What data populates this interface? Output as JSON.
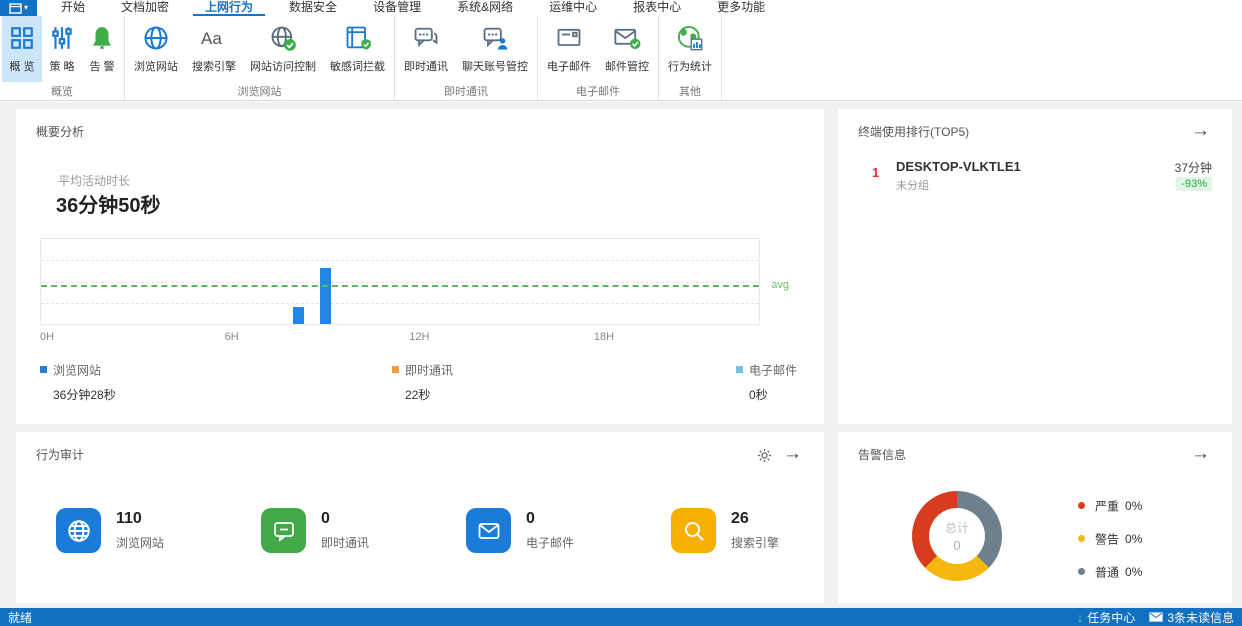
{
  "app": {
    "menu_button_caret": "▾",
    "tabs": [
      "开始",
      "文档加密",
      "上网行为",
      "数据安全",
      "设备管理",
      "系统&网络",
      "运维中心",
      "报表中心",
      "更多功能"
    ],
    "active_tab": "上网行为",
    "accent_color": "#1374cf",
    "ribbon": {
      "groups": [
        {
          "label": "概览",
          "buttons": [
            {
              "label": "概 览"
            },
            {
              "label": "策 略"
            },
            {
              "label": "告 警"
            }
          ]
        },
        {
          "label": "浏览网站",
          "buttons": [
            {
              "label": "浏览网站"
            },
            {
              "label": "搜索引擎"
            },
            {
              "label": "网站访问控制"
            },
            {
              "label": "敏感词拦截"
            }
          ]
        },
        {
          "label": "即时通讯",
          "buttons": [
            {
              "label": "即时通讯"
            },
            {
              "label": "聊天账号管控"
            }
          ]
        },
        {
          "label": "电子邮件",
          "buttons": [
            {
              "label": "电子邮件"
            },
            {
              "label": "邮件管控"
            }
          ]
        },
        {
          "label": "其他",
          "buttons": [
            {
              "label": "行为统计"
            }
          ]
        }
      ]
    }
  },
  "summary_panel": {
    "title": "概要分析",
    "avg_label": "平均活动时长",
    "avg_value": "36分钟50秒",
    "chart_data": {
      "type": "bar",
      "title": "平均活动时长 36分钟50秒",
      "x_ticks": [
        {
          "label": "0H",
          "hour": 0
        },
        {
          "label": "6H",
          "hour": 6
        },
        {
          "label": "12H",
          "hour": 12
        },
        {
          "label": "18H",
          "hour": 18
        }
      ],
      "x_range_hours": [
        0,
        24
      ],
      "bars": [
        {
          "hour": 8.2,
          "height_pct": 20
        },
        {
          "hour": 9.1,
          "height_pct": 66
        }
      ],
      "bar_color": "#2086e8",
      "avg_line": {
        "label": "avg",
        "height_pct": 44,
        "color": "#5cb85c"
      },
      "grid": "dashed horizontal"
    },
    "legend": [
      {
        "label": "浏览网站",
        "value": "36分钟28秒",
        "color": "#2a7ed1"
      },
      {
        "label": "即时通讯",
        "value": "22秒",
        "color": "#f09f3c"
      },
      {
        "label": "电子邮件",
        "value": "0秒",
        "color": "#74c3e2"
      }
    ]
  },
  "ranking_panel": {
    "title": "终端使用排行(TOP5)",
    "items": [
      {
        "rank": "1",
        "name": "DESKTOP-VLKTLE1",
        "group": "未分组",
        "duration": "37分钟",
        "change": "-93%",
        "rank_color": "#e03131",
        "change_color": "#28a745"
      }
    ]
  },
  "audit_panel": {
    "title": "行为审计",
    "stats": [
      {
        "value": "110",
        "label": "浏览网站",
        "icon": "globe-icon",
        "color": "#1a7cd8"
      },
      {
        "value": "0",
        "label": "即时通讯",
        "icon": "chat-icon",
        "color": "#43a848"
      },
      {
        "value": "0",
        "label": "电子邮件",
        "icon": "mail-icon",
        "color": "#1a7cd8"
      },
      {
        "value": "26",
        "label": "搜索引擎",
        "icon": "search-icon",
        "color": "#f7af00"
      }
    ]
  },
  "alarm_panel": {
    "title": "告警信息",
    "chart_data": {
      "type": "pie",
      "center_label": "总计",
      "center_value": "0",
      "segments": [
        {
          "name": "普通",
          "color": "#6e7f8d",
          "from_deg": 0,
          "to_deg": 135
        },
        {
          "name": "警告",
          "color": "#f6b70f",
          "from_deg": 135,
          "to_deg": 225
        },
        {
          "name": "严重",
          "color": "#d63c1d",
          "from_deg": 225,
          "to_deg": 360
        }
      ]
    },
    "legend": [
      {
        "label": "严重",
        "value": "0%",
        "color": "#d63c1d"
      },
      {
        "label": "警告",
        "value": "0%",
        "color": "#f6b70f"
      },
      {
        "label": "普通",
        "value": "0%",
        "color": "#6e7f8d"
      }
    ]
  },
  "statusbar": {
    "left": "就绪",
    "task_center": "任务中心",
    "unread": "3条未读信息",
    "bar_color": "#1270c2"
  }
}
